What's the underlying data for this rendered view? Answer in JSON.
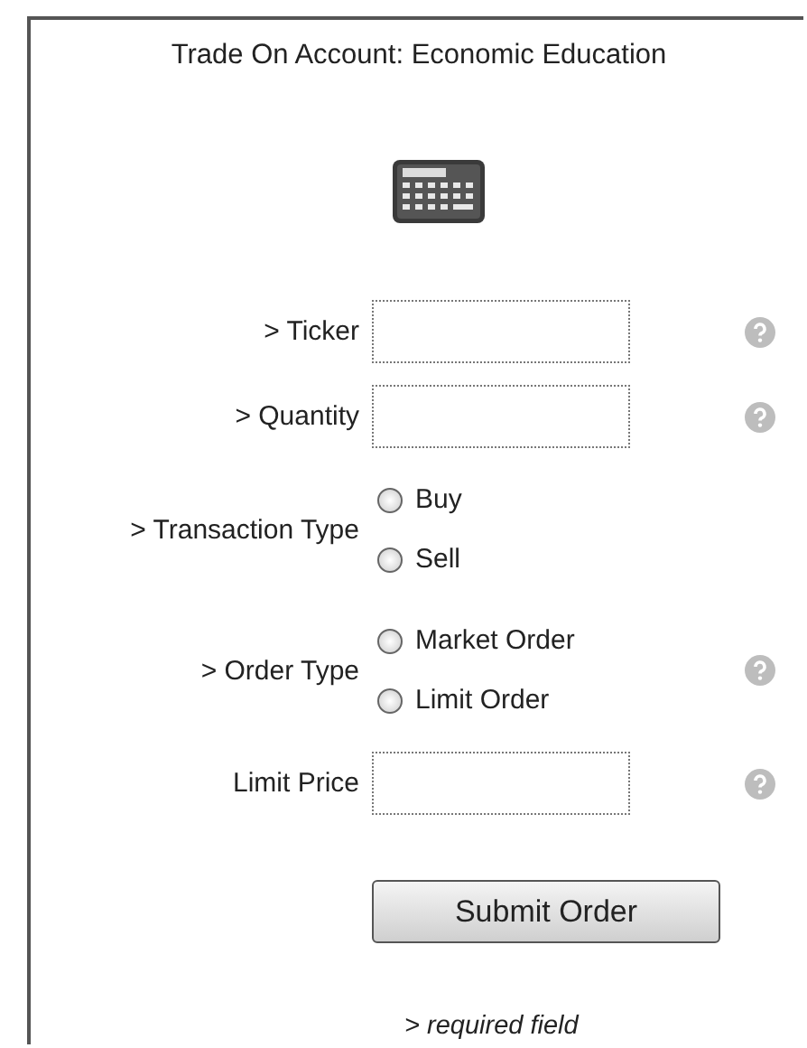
{
  "title": "Trade On Account: Economic Education",
  "fields": [
    {
      "kind": "text",
      "label": "> Ticker",
      "help": true
    },
    {
      "kind": "text",
      "label": "> Quantity",
      "help": true
    },
    {
      "kind": "radio",
      "label": "> Transaction Type",
      "help": false,
      "options": [
        {
          "label": "Buy",
          "selected": false
        },
        {
          "label": "Sell",
          "selected": false
        }
      ]
    },
    {
      "kind": "radio",
      "label": "> Order Type",
      "help": true,
      "options": [
        {
          "label": "Market Order",
          "selected": false
        },
        {
          "label": "Limit Order",
          "selected": false
        }
      ]
    },
    {
      "kind": "text",
      "label": "Limit Price",
      "help": true
    }
  ],
  "submit": "Submit Order",
  "note": "> required field"
}
